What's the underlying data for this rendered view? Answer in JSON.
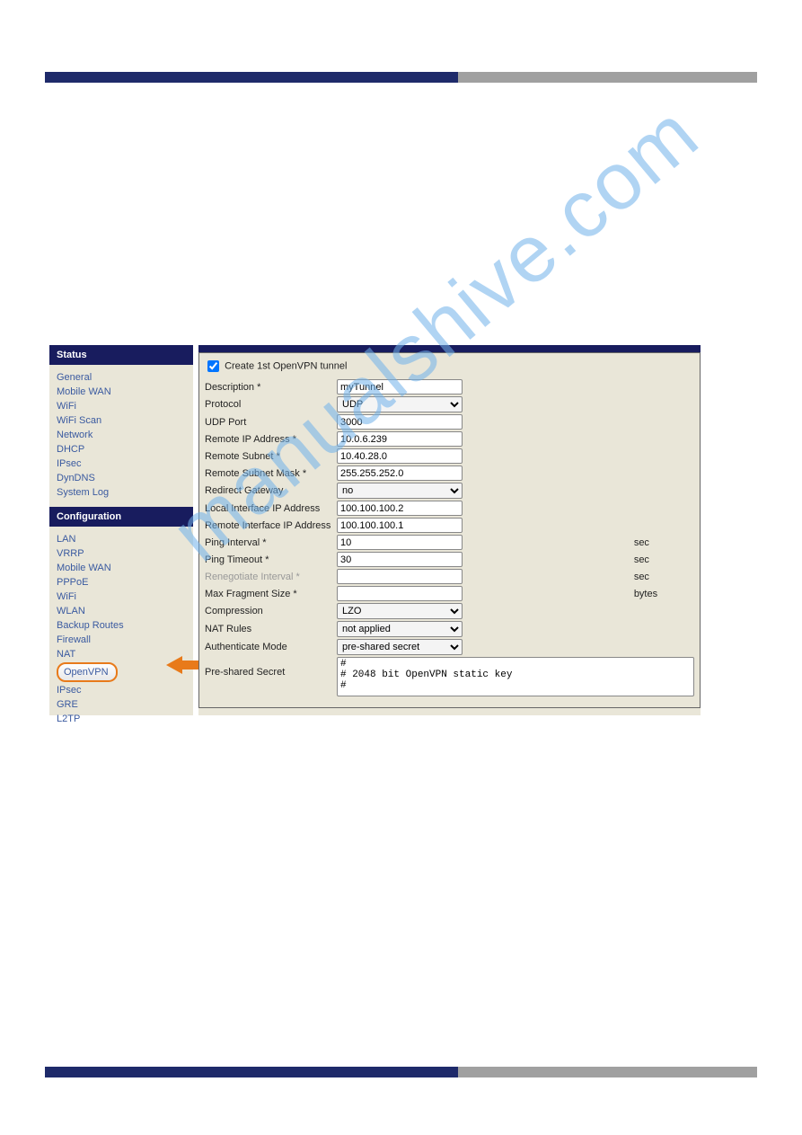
{
  "watermark_text": "manualshive.com",
  "sidebar": {
    "status_header": "Status",
    "status_items": [
      "General",
      "Mobile WAN",
      "WiFi",
      "WiFi Scan",
      "Network",
      "DHCP",
      "IPsec",
      "DynDNS",
      "System Log"
    ],
    "config_header": "Configuration",
    "config_items": [
      "LAN",
      "VRRP",
      "Mobile WAN",
      "PPPoE",
      "WiFi",
      "WLAN",
      "Backup Routes",
      "Firewall",
      "NAT",
      "OpenVPN",
      "IPsec",
      "GRE",
      "L2TP"
    ],
    "highlighted": "OpenVPN"
  },
  "form": {
    "create_label": "Create 1st OpenVPN tunnel",
    "create_checked": true,
    "rows": {
      "description": {
        "label": "Description *",
        "value": "myTunnel"
      },
      "protocol": {
        "label": "Protocol",
        "value": "UDP"
      },
      "udp_port": {
        "label": "UDP Port",
        "value": "3000"
      },
      "remote_ip": {
        "label": "Remote IP Address *",
        "value": "10.0.6.239"
      },
      "remote_subnet": {
        "label": "Remote Subnet *",
        "value": "10.40.28.0"
      },
      "remote_mask": {
        "label": "Remote Subnet Mask *",
        "value": "255.255.252.0"
      },
      "redirect_gw": {
        "label": "Redirect Gateway",
        "value": "no"
      },
      "local_if": {
        "label": "Local Interface IP Address",
        "value": "100.100.100.2"
      },
      "remote_if": {
        "label": "Remote Interface IP Address",
        "value": "100.100.100.1"
      },
      "ping_interval": {
        "label": "Ping Interval *",
        "value": "10",
        "unit": "sec"
      },
      "ping_timeout": {
        "label": "Ping Timeout *",
        "value": "30",
        "unit": "sec"
      },
      "reneg": {
        "label": "Renegotiate Interval *",
        "value": "",
        "unit": "sec"
      },
      "max_frag": {
        "label": "Max Fragment Size *",
        "value": "",
        "unit": "bytes"
      },
      "compression": {
        "label": "Compression",
        "value": "LZO"
      },
      "nat_rules": {
        "label": "NAT Rules",
        "value": "not applied"
      },
      "auth_mode": {
        "label": "Authenticate Mode",
        "value": "pre-shared secret"
      },
      "preshared": {
        "label": "Pre-shared Secret",
        "value": "#\n# 2048 bit OpenVPN static key\n#"
      }
    }
  }
}
